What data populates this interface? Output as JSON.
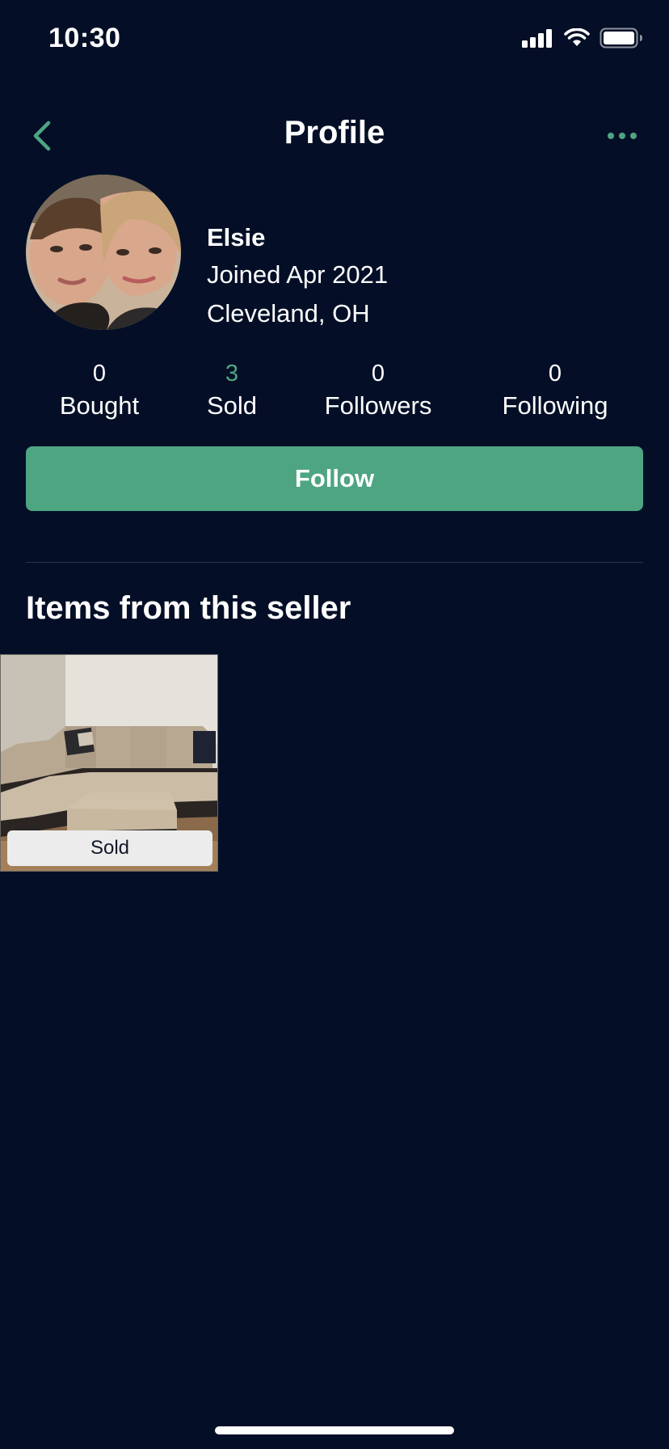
{
  "status_bar": {
    "time": "10:30",
    "icons": [
      "signal-icon",
      "wifi-icon",
      "battery-icon"
    ]
  },
  "nav": {
    "title": "Profile",
    "back_icon": "chevron-left-icon",
    "more_icon": "more-horizontal-icon"
  },
  "profile": {
    "name": "Elsie",
    "joined": "Joined Apr 2021",
    "location": "Cleveland, OH",
    "avatar": "avatar-photo"
  },
  "stats": [
    {
      "value": "0",
      "label": "Bought"
    },
    {
      "value": "3",
      "label": "Sold"
    },
    {
      "value": "0",
      "label": "Followers"
    },
    {
      "value": "0",
      "label": "Following"
    }
  ],
  "follow_button": "Follow",
  "items_section": {
    "title": "Items from this seller",
    "items": [
      {
        "badge": "Sold",
        "image": "sectional-sofa-photo"
      }
    ]
  },
  "colors": {
    "background": "#040f27",
    "accent": "#4ea582",
    "text": "#ffffff",
    "badge_bg": "#ececec"
  }
}
